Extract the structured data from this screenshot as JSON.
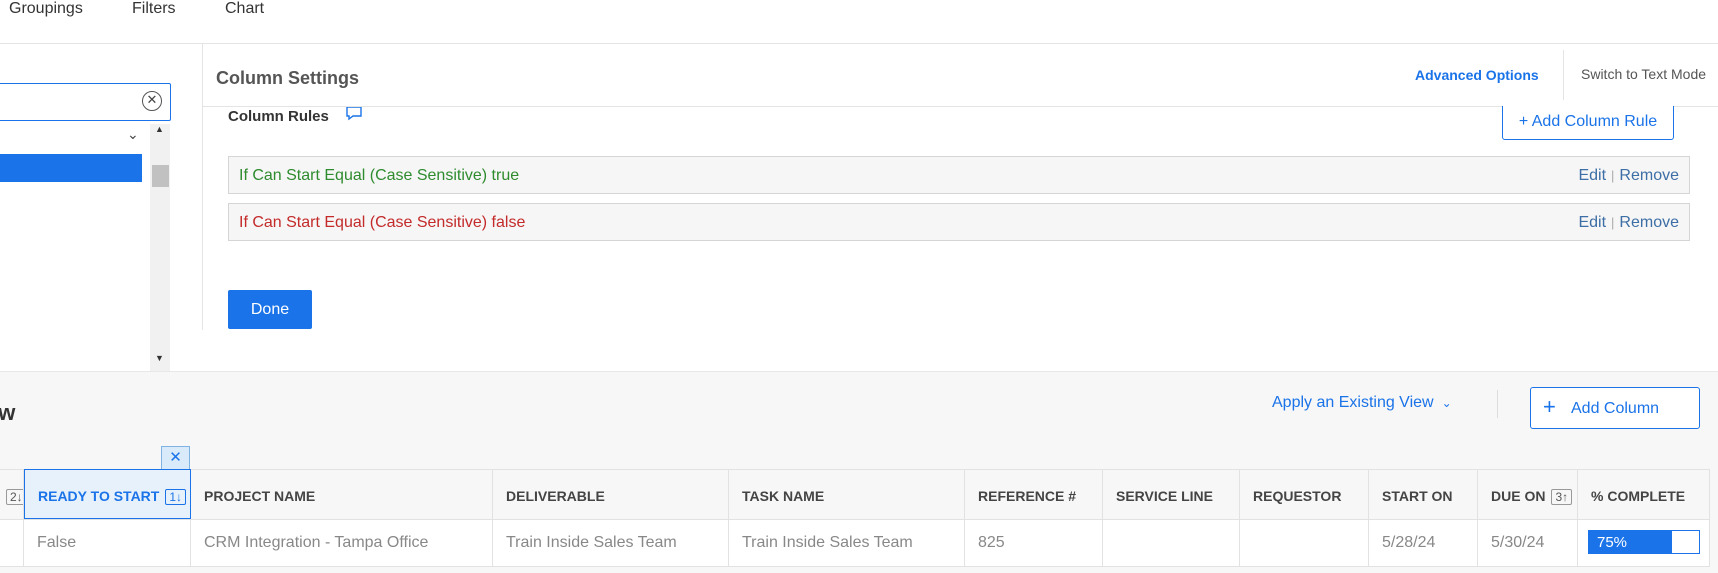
{
  "top_tabs": [
    "Groupings",
    "Filters",
    "Chart"
  ],
  "column_settings": {
    "title": "Column Settings",
    "advanced_options": "Advanced Options",
    "switch_text_mode": "Switch to Text Mode",
    "rules_label": "Column Rules",
    "add_rule": "+ Add Column Rule",
    "rules": [
      {
        "text": "If Can Start Equal (Case Sensitive) true",
        "status": "true",
        "edit": "Edit",
        "remove": "Remove"
      },
      {
        "text": "If Can Start Equal (Case Sensitive) false",
        "status": "false",
        "edit": "Edit",
        "remove": "Remove"
      }
    ],
    "done": "Done"
  },
  "view": {
    "title": "ew",
    "apply_existing_view": "Apply an Existing View",
    "add_column": "Add Column",
    "close_column_symbol": "✕"
  },
  "table": {
    "columns": [
      {
        "label": "",
        "sort": "2↓"
      },
      {
        "label": "READY TO START",
        "sort": "1↓",
        "active": true
      },
      {
        "label": "PROJECT NAME",
        "sort": ""
      },
      {
        "label": "DELIVERABLE",
        "sort": ""
      },
      {
        "label": "TASK NAME",
        "sort": ""
      },
      {
        "label": "REFERENCE #",
        "sort": ""
      },
      {
        "label": "SERVICE LINE",
        "sort": ""
      },
      {
        "label": "REQUESTOR",
        "sort": ""
      },
      {
        "label": "START ON",
        "sort": ""
      },
      {
        "label": "DUE ON",
        "sort": "3↑"
      },
      {
        "label": "% COMPLETE",
        "sort": ""
      }
    ],
    "row": [
      "",
      "False",
      "CRM Integration - Tampa Office",
      "Train Inside Sales Team",
      "Train Inside Sales Team",
      "825",
      "",
      "",
      "5/28/24",
      "5/30/24"
    ],
    "percent_complete": "75%",
    "percent_value": 0.75
  },
  "colors": {
    "accent": "#1a73e8",
    "rule_true": "#2e8b2e",
    "rule_false": "#c42a2a"
  }
}
